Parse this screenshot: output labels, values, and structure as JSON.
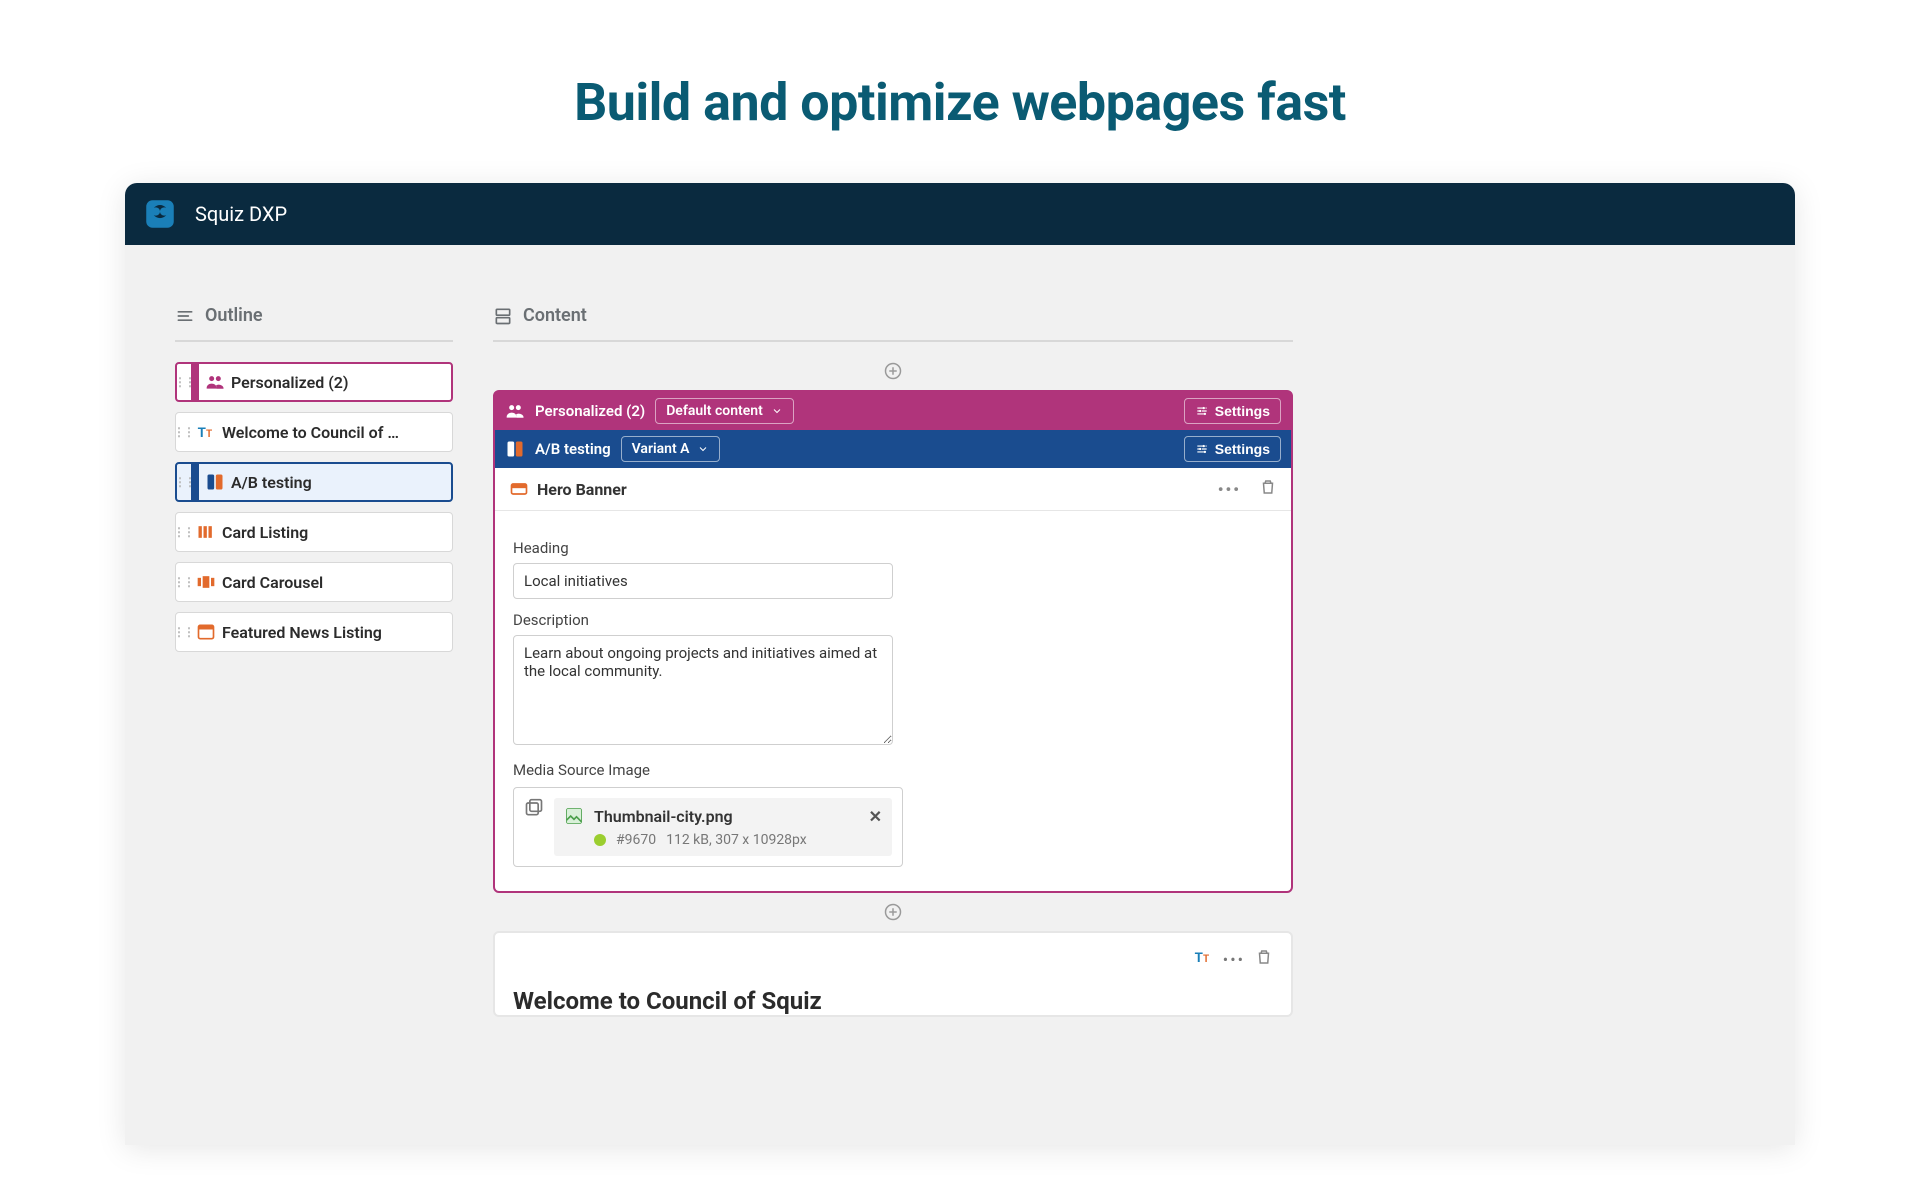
{
  "marketing_heading": "Build and optimize webpages fast",
  "app": {
    "name": "Squiz DXP"
  },
  "columns": {
    "outline": "Outline",
    "content": "Content"
  },
  "outline": {
    "items": [
      {
        "label": "Personalized (2)",
        "icon": "people",
        "variant": "active-pink"
      },
      {
        "label": "Welcome to Council of …",
        "icon": "tt",
        "variant": ""
      },
      {
        "label": "A/B testing",
        "icon": "split",
        "variant": "active-blue"
      },
      {
        "label": "Card Listing",
        "icon": "cards",
        "variant": ""
      },
      {
        "label": "Card Carousel",
        "icon": "carousel",
        "variant": ""
      },
      {
        "label": "Featured News Listing",
        "icon": "news",
        "variant": ""
      }
    ]
  },
  "editor": {
    "personalized": {
      "label": "Personalized (2)",
      "dropdown": "Default content",
      "settings": "Settings"
    },
    "abtest": {
      "label": "A/B testing",
      "dropdown": "Variant A",
      "settings": "Settings"
    },
    "component": {
      "name": "Hero Banner",
      "fields": {
        "heading_label": "Heading",
        "heading_value": "Local initiatives",
        "description_label": "Description",
        "description_value": "Learn about ongoing projects and initiatives aimed at the local community.",
        "media_label": "Media Source Image",
        "media": {
          "filename": "Thumbnail-city.png",
          "id": "#9670",
          "meta": "112 kB, 307 x 10928px"
        }
      }
    },
    "next_block_title": "Welcome to Council of Squiz"
  }
}
